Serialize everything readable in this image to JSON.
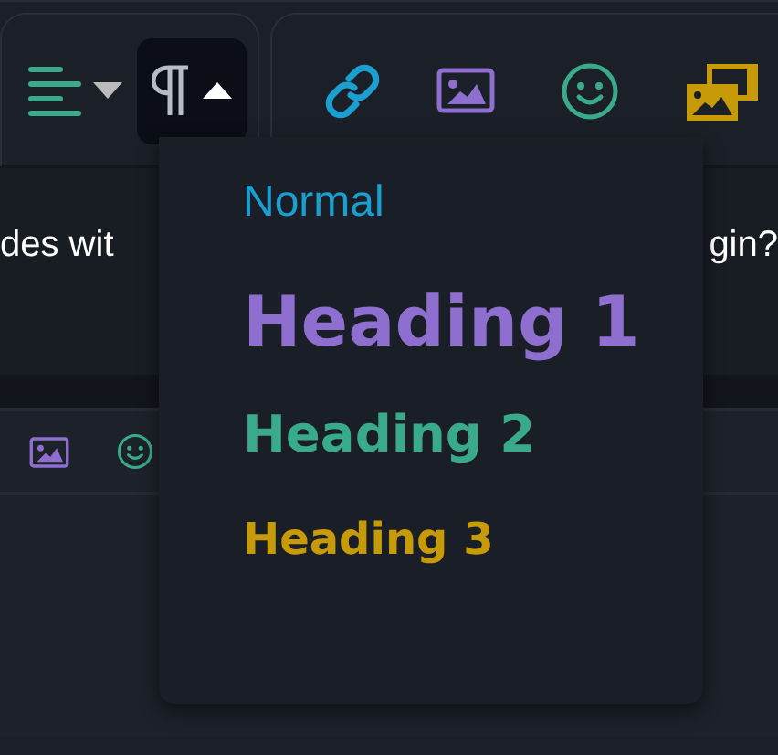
{
  "toolbar": {
    "buttons": [
      {
        "kind": "align",
        "expanded": false,
        "selected": false
      },
      {
        "kind": "paragraph",
        "expanded": true,
        "selected": true
      },
      {
        "kind": "link",
        "selected": false
      },
      {
        "kind": "image",
        "selected": false
      },
      {
        "kind": "emoji",
        "selected": false
      },
      {
        "kind": "media",
        "selected": false
      }
    ]
  },
  "editor": {
    "texts": [
      "des wit",
      "gin?"
    ]
  },
  "toolbar_2": {
    "buttons": [
      {
        "kind": "image"
      },
      {
        "kind": "emoji"
      }
    ]
  },
  "dropdown": {
    "items": [
      {
        "label": "Normal",
        "kind": "normal",
        "color": "#1a9fd0"
      },
      {
        "label": "Heading 1",
        "kind": "h1",
        "color": "#8e6fd0"
      },
      {
        "label": "Heading 2",
        "kind": "h2",
        "color": "#3aaa8c"
      },
      {
        "label": "Heading 3",
        "kind": "h3",
        "color": "#c79a0a"
      }
    ]
  }
}
